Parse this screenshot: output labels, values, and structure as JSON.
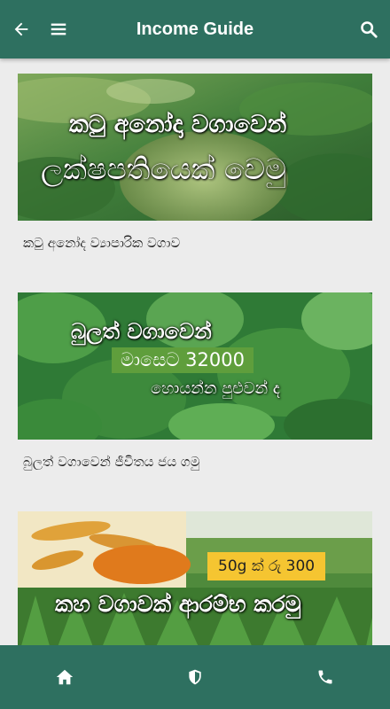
{
  "appbar": {
    "title": "Income Guide",
    "back_icon": "arrow-left-icon",
    "menu_icon": "hamburger-menu-icon",
    "search_icon": "search-icon",
    "color": "#2e7060"
  },
  "articles": [
    {
      "banner_line1": "කටු අනෝදා වගාවෙන්",
      "banner_line2": "ලක්ෂපතියෙක් වෙමු",
      "caption": "කටු අනෝද ව්‍යාපාරික වගාව"
    },
    {
      "banner_line1": "බුලත් වගාවෙන්",
      "banner_tag": "මාසෙට 32000",
      "banner_line3": "හොයන්න පුළුවන් ද",
      "caption": "බුලත් වගාවෙන් ජීවිතය ජය ගමු"
    },
    {
      "banner_tag": "50g ක් රු 300",
      "banner_line1": "කහ වගාවක් ආරම්භ කරමු",
      "caption": ""
    }
  ],
  "bottom_nav": {
    "items": [
      {
        "icon": "home-icon"
      },
      {
        "icon": "shield-icon"
      },
      {
        "icon": "phone-icon"
      }
    ]
  }
}
